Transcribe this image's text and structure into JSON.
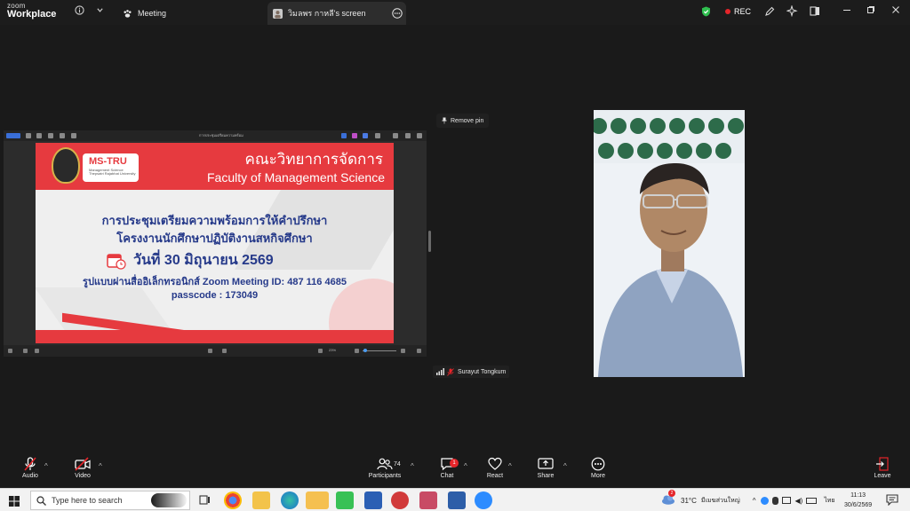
{
  "titlebar": {
    "logo_line1": "zoom",
    "logo_line2": "Workplace",
    "tab_meeting": "Meeting",
    "tab_screen": "วิมลพร กาหลี's screen",
    "rec": "REC"
  },
  "share": {
    "window_title": "การประชุมเตรียมความพร้อม",
    "zoom_level": "23%"
  },
  "slide": {
    "ms_title": "MS-TRU",
    "ms_sub1": "Management Science",
    "ms_sub2": "Thepsatri Rajabhat University",
    "faculty_th": "คณะวิทยาการจัดการ",
    "faculty_en": "Faculty of Management Science",
    "line1": "การประชุมเตรียมความพร้อมการให้คำปรึกษา",
    "line2": "โครงงานนักศึกษาปฏิบัติงานสหกิจศึกษา",
    "line3": "วันที่ 30 มิถุนายน 2569",
    "line4": "รูปแบบผ่านสื่ออิเล็กทรอนิกส์ Zoom Meeting ID: 487 116 4685",
    "line5": "passcode : 173049"
  },
  "pin": {
    "label": "Remove pin"
  },
  "participant": {
    "name": "Surayut Tongkum"
  },
  "controls": {
    "audio": "Audio",
    "video": "Video",
    "participants": "Participants",
    "participants_count": "74",
    "chat": "Chat",
    "chat_badge": "1",
    "react": "React",
    "share": "Share",
    "more": "More",
    "leave": "Leave"
  },
  "taskbar": {
    "search_placeholder": "Type here to search",
    "weather_badge": "2",
    "temperature": "31°C",
    "weather_desc": "มีเมฆส่วนใหญ่",
    "lang": "ไทย",
    "time": "11:13",
    "date": "30/6/2569"
  },
  "colors": {
    "accent_red": "#e63a3f",
    "slide_blue": "#263a8a",
    "shield_green": "#2fbf4f"
  }
}
